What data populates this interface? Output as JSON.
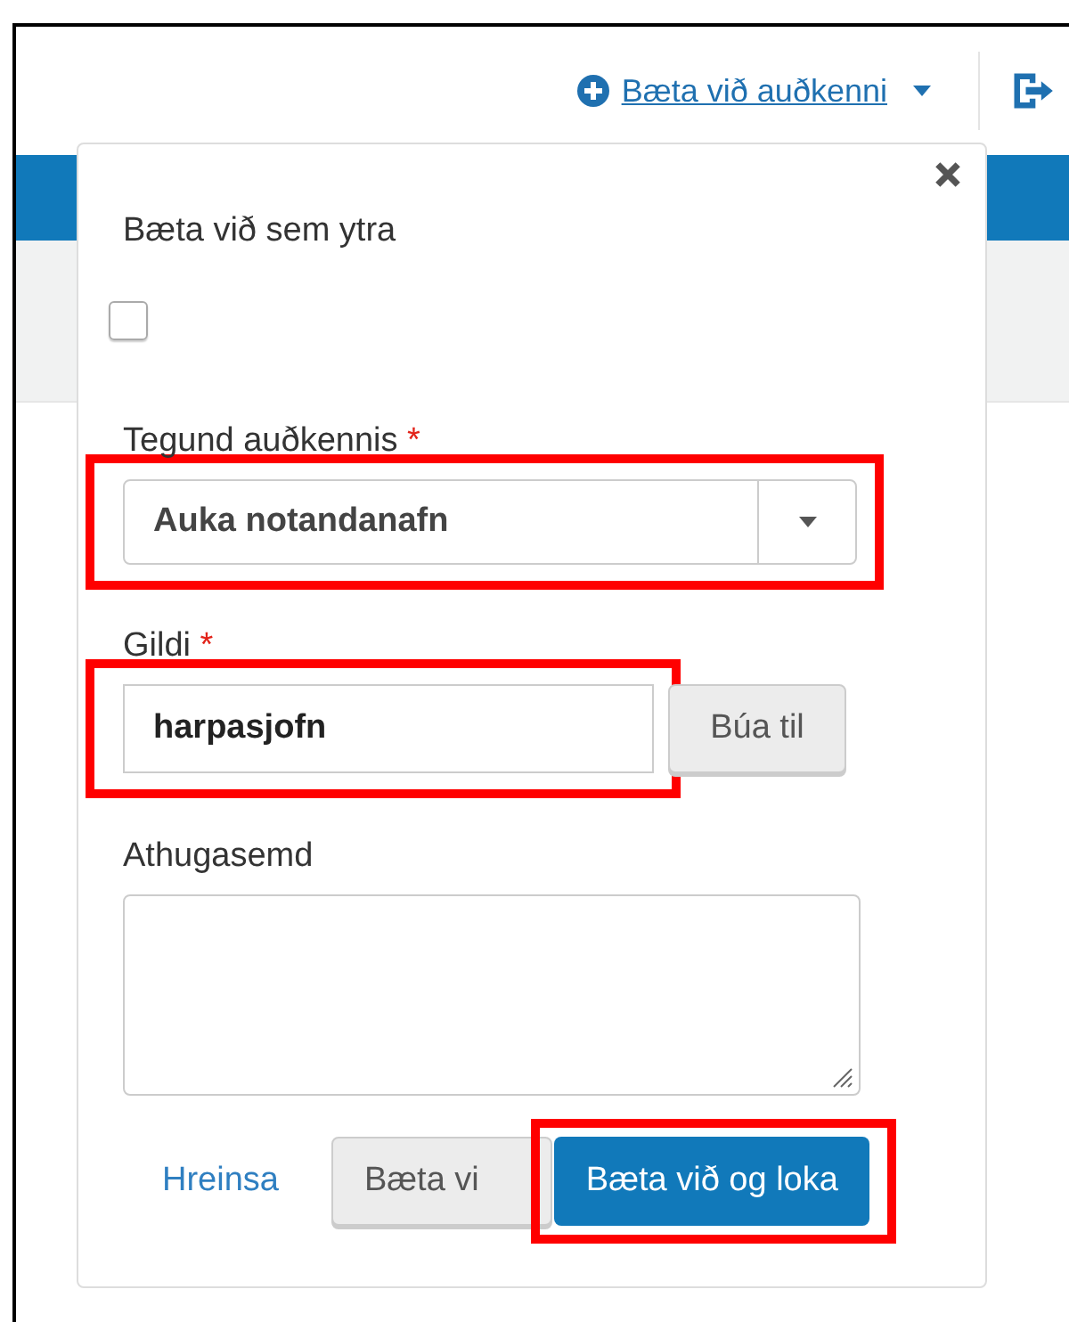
{
  "header": {
    "add_link": "Bæta við auðkenni"
  },
  "popup": {
    "external": {
      "label": "Bæta við sem ytra",
      "checked": false
    },
    "type_field": {
      "label": "Tegund auðkennis",
      "required": "*",
      "value": "Auka notandanafn",
      "highlighted": true
    },
    "value_field": {
      "label": "Gildi",
      "required": "*",
      "value": "harpasjofn",
      "highlighted": true,
      "generate_button": "Búa til"
    },
    "note_field": {
      "label": "Athugasemd"
    },
    "actions": [
      {
        "kind": "link",
        "label": "Hreinsa",
        "highlighted": false
      },
      {
        "kind": "secondary",
        "label": "Bæta vi",
        "highlighted": false
      },
      {
        "kind": "primary",
        "label": "Bæta við og loka",
        "highlighted": true
      }
    ]
  }
}
